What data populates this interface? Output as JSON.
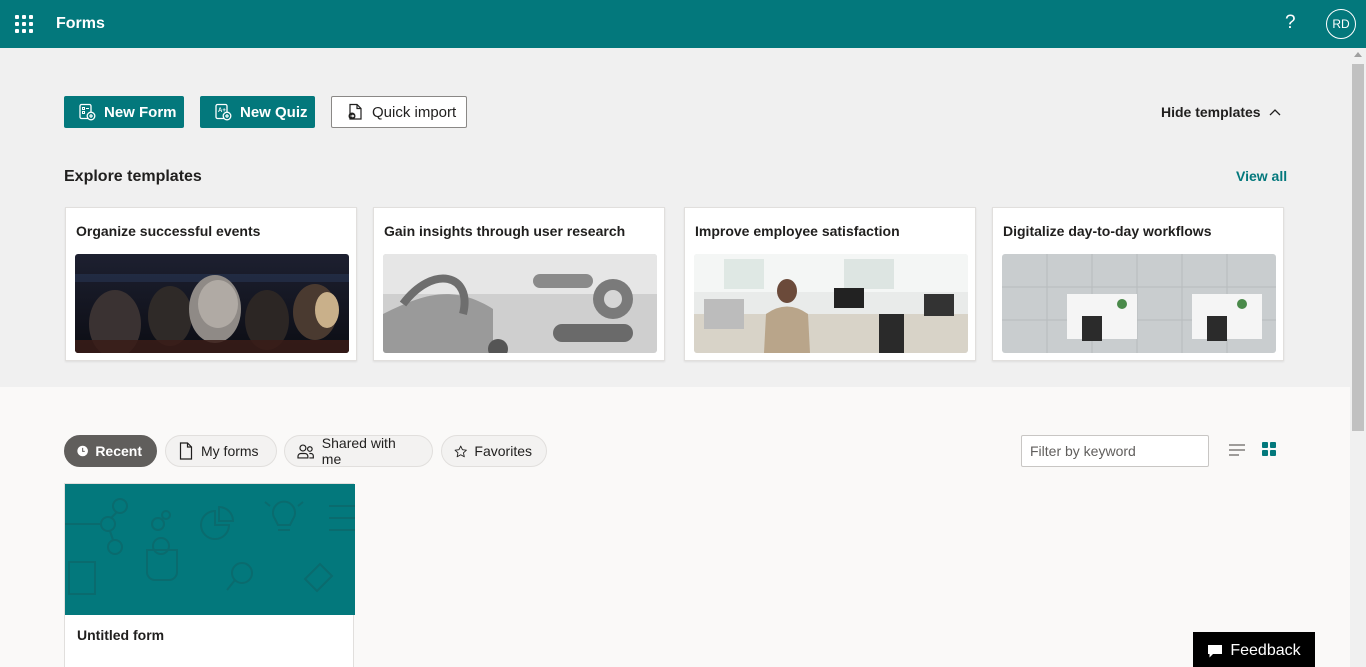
{
  "header": {
    "app_title": "Forms",
    "help": "?",
    "avatar_initials": "RD"
  },
  "actions": {
    "new_form": "New Form",
    "new_quiz": "New Quiz",
    "quick_import": "Quick import",
    "hide_templates": "Hide templates"
  },
  "templates": {
    "title": "Explore templates",
    "view_all": "View all",
    "cards": [
      {
        "title": "Organize successful events",
        "image": "audience-photo"
      },
      {
        "title": "Gain insights through user research",
        "image": "machine-parts-photo"
      },
      {
        "title": "Improve employee satisfaction",
        "image": "office-worker-photo"
      },
      {
        "title": "Digitalize day-to-day workflows",
        "image": "office-desks-aerial-photo"
      }
    ]
  },
  "filters": {
    "tabs": [
      {
        "label": "Recent",
        "icon": "clock-icon",
        "active": true
      },
      {
        "label": "My forms",
        "icon": "document-icon",
        "active": false
      },
      {
        "label": "Shared with me",
        "icon": "people-icon",
        "active": false
      },
      {
        "label": "Favorites",
        "icon": "star-icon",
        "active": false
      }
    ],
    "search_placeholder": "Filter by keyword"
  },
  "forms": [
    {
      "name": "Untitled form"
    }
  ],
  "feedback_label": "Feedback",
  "colors": {
    "brand": "#03787c",
    "active_pill": "#605e5c"
  }
}
